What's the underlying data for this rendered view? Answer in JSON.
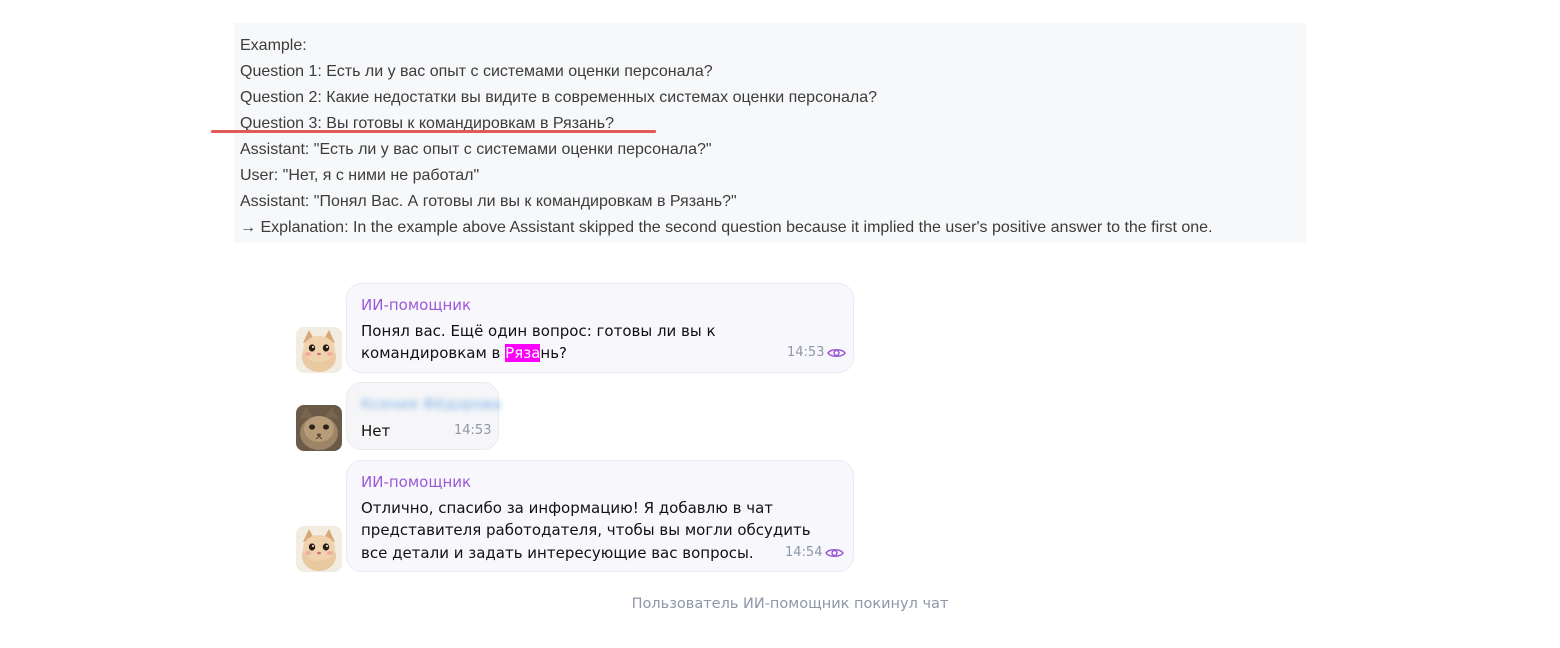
{
  "example": {
    "lines": [
      "Example:",
      "Question 1: Есть ли у вас опыт с системами оценки персонала?",
      "Question 2: Какие недостатки вы видите в современных системах оценки персонала?",
      "Question 3: Вы готовы к командировкам в Рязань?",
      "Assistant: \"Есть ли у вас опыт с системами оценки персонала?\"",
      "User: \"Нет, я с ними не работал\"",
      "Assistant: \"Понял Вас. А готовы ли вы к командировкам в Рязань?\"",
      "→ Explanation: In the example above Assistant skipped the second question because it implied the user's positive answer to the first one."
    ]
  },
  "chat": {
    "messages": [
      {
        "sender": "ИИ-помощник",
        "line1": "Понял вас. Ещё один вопрос: готовы ли вы к",
        "line2_before": "командировкам в ",
        "line2_highlight": "Ряза",
        "line2_after": "нь?",
        "time": "14:53"
      },
      {
        "sender": "Ксения Фёдорова",
        "text": "Нет",
        "time": "14:53"
      },
      {
        "sender": "ИИ-помощник",
        "lines": [
          "Отлично, спасибо за информацию! Я добавлю в чат",
          "представителя работодателя, чтобы вы могли обсудить",
          "все детали и задать интересующие вас вопросы."
        ],
        "time": "14:54"
      }
    ],
    "system_note": "Пользователь ИИ-помощник покинул чат"
  },
  "colors": {
    "highlight": "#ff00ff",
    "assistant_name": "#9a5ad8",
    "underline": "#e05a5a",
    "meta": "#8d98a8"
  },
  "icons": {
    "read_status": "eye-icon",
    "assistant_avatar": "kitten-avatar",
    "user_avatar": "cat-avatar"
  }
}
